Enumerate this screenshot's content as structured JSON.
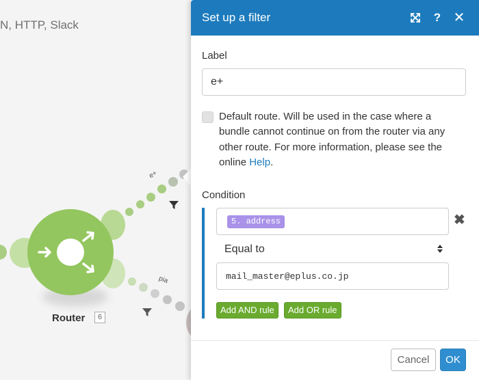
{
  "canvas": {
    "apps_list_text": "N, HTTP, Slack",
    "router": {
      "label": "Router",
      "module_number": "6"
    },
    "routes": [
      {
        "label": "e+"
      },
      {
        "label": "pia"
      }
    ]
  },
  "dialog": {
    "title": "Set up a filter",
    "header_icons": [
      "expand-icon",
      "help-icon",
      "close-icon"
    ],
    "help_glyph": "?",
    "close_glyph": "✕",
    "label_field": {
      "label": "Label",
      "value": "e+"
    },
    "default_route": {
      "checked": false,
      "text_before_link": "Default route. Will be used in the case where a bundle cannot continue on from the router via any other route. For more information, please see the online ",
      "link_text": "Help",
      "text_after_link": "."
    },
    "condition": {
      "label": "Condition",
      "operand": "5. address",
      "operator": "Equal to",
      "value": "mail_master@eplus.co.jp",
      "remove_glyph": "✖",
      "add_and_label": "Add AND rule",
      "add_or_label": "Add OR rule"
    },
    "footer": {
      "cancel_label": "Cancel",
      "ok_label": "OK"
    }
  },
  "colors": {
    "header_blue": "#1d7bbd",
    "router_green": "#93c65e",
    "rule_button_green": "#6aab2f",
    "pill_purple": "#a992e8",
    "ok_blue": "#2f8ecf"
  }
}
